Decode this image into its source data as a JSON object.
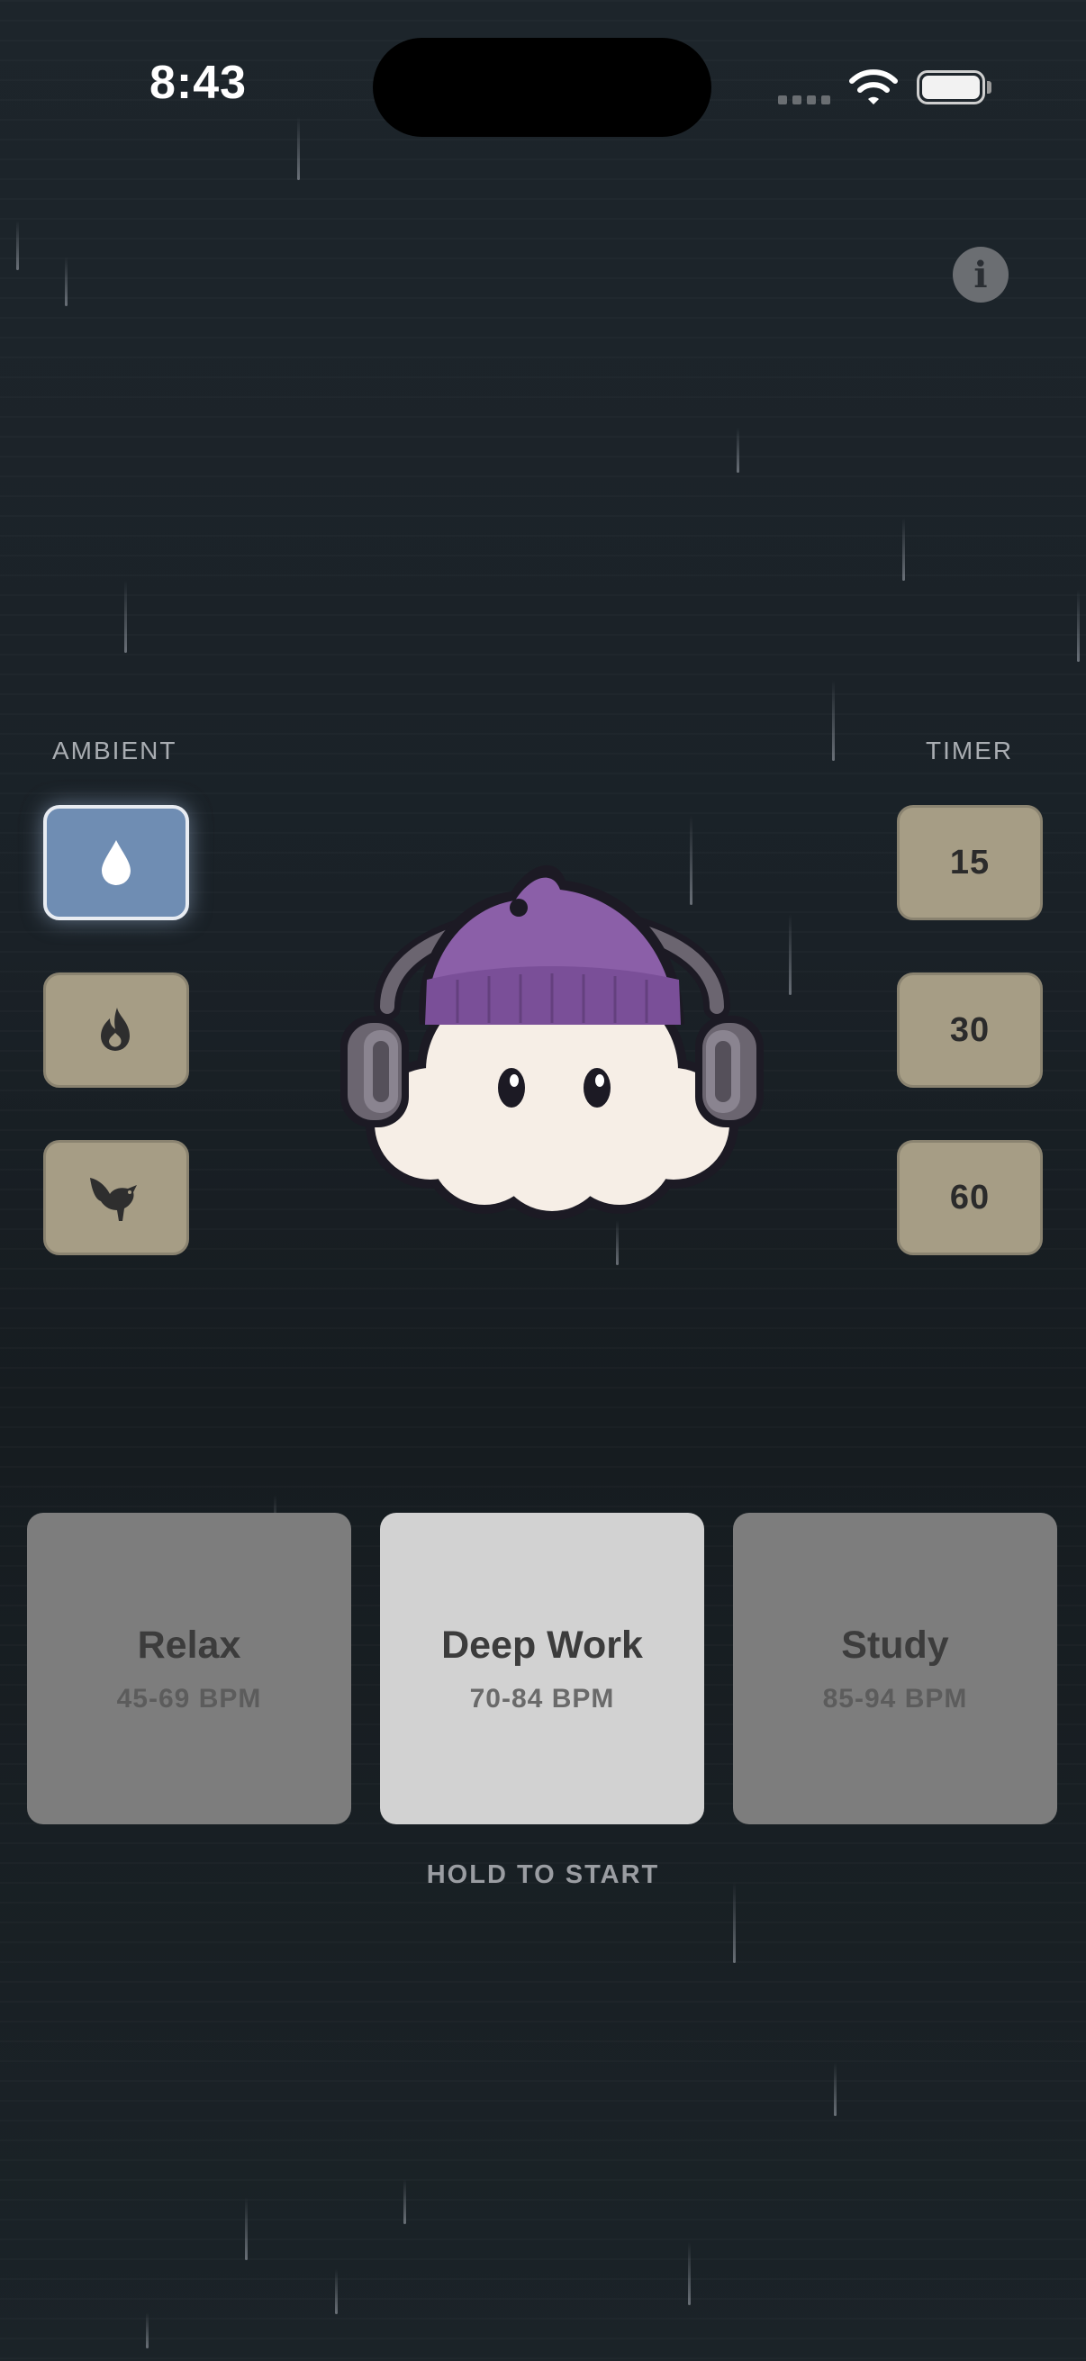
{
  "status_bar": {
    "time": "8:43"
  },
  "info_button": {
    "icon": "info-icon",
    "glyph": "i"
  },
  "ambient": {
    "label": "AMBIENT",
    "items": [
      {
        "name": "rain",
        "icon": "raindrop-icon",
        "active": true
      },
      {
        "name": "fire",
        "icon": "flame-icon",
        "active": false
      },
      {
        "name": "birds",
        "icon": "bird-icon",
        "active": false
      }
    ]
  },
  "timer": {
    "label": "TIMER",
    "options": [
      "15",
      "30",
      "60"
    ]
  },
  "mascot": {
    "icon": "cloud-mascot-icon"
  },
  "modes": [
    {
      "name": "Relax",
      "bpm": "45-69 BPM",
      "active": false
    },
    {
      "name": "Deep Work",
      "bpm": "70-84 BPM",
      "active": true
    },
    {
      "name": "Study",
      "bpm": "85-94 BPM",
      "active": false
    }
  ],
  "hint": "HOLD TO START",
  "colors": {
    "background": "#1a2127",
    "tile_active": "#6f8db3",
    "tile_inactive": "#a69d85",
    "mode_active": "#d2d2d2",
    "mode_inactive": "#7d7d7d",
    "hat_purple": "#8b5fa8"
  }
}
